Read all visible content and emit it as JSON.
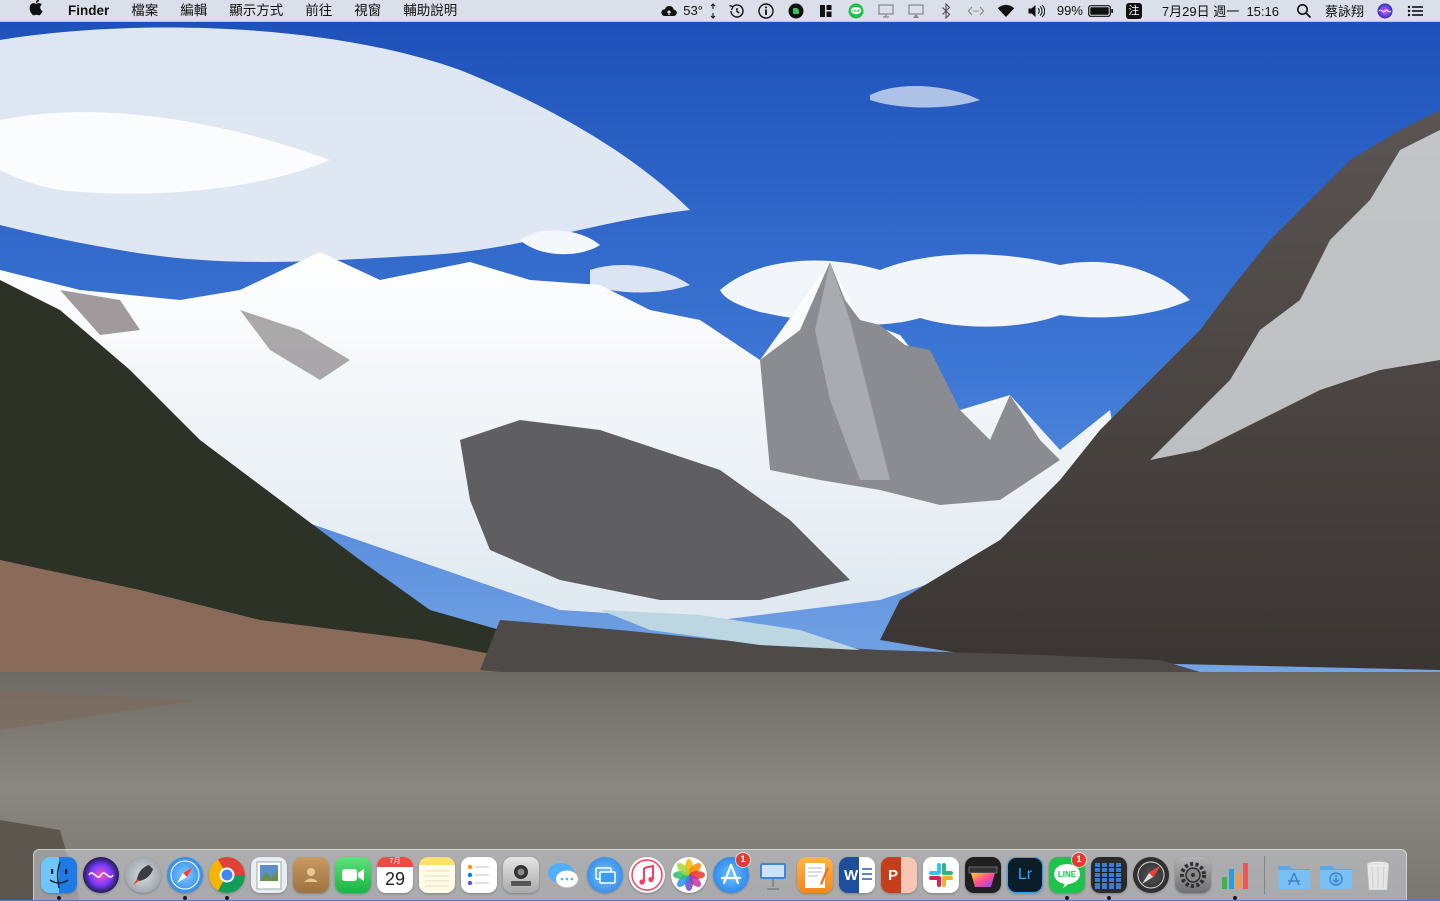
{
  "menubar": {
    "apple_icon": "apple-logo-icon",
    "app_name": "Finder",
    "menus": [
      "檔案",
      "編輯",
      "顯示方式",
      "前往",
      "視窗",
      "輔助說明"
    ],
    "weather_temp": "53°",
    "battery_percent": "99%",
    "input_method": "注",
    "datetime": "7月29日 週一  15:16",
    "user_name": "蔡詠翔",
    "status_icons": [
      "weather-cloud-icon",
      "expand-icon",
      "time-machine-icon",
      "info-icon",
      "evernote-icon",
      "layout-icon",
      "line-icon",
      "screen-mirror-icon",
      "airplay-icon",
      "bluetooth-icon",
      "network-arrows-icon",
      "wifi-icon",
      "volume-icon",
      "battery-icon",
      "input-method-icon",
      "spotlight-icon",
      "siri-icon",
      "notification-center-icon"
    ]
  },
  "calendar_icon": {
    "month": "7月",
    "day": "29"
  },
  "dock": {
    "badges": {
      "app_store": "1",
      "line": "1"
    },
    "apps": [
      {
        "name": "Finder",
        "icon": "finder-icon",
        "color": "#2f8cf0",
        "running": true
      },
      {
        "name": "Siri",
        "icon": "siri-icon",
        "color": "#3a3a8c",
        "running": false
      },
      {
        "name": "Launchpad",
        "icon": "launchpad-icon",
        "color": "#9aa3ad",
        "running": false
      },
      {
        "name": "Safari",
        "icon": "safari-icon",
        "color": "#2d8ff0",
        "running": true
      },
      {
        "name": "Chrome",
        "icon": "chrome-icon",
        "color": "#ffffff",
        "running": true
      },
      {
        "name": "Preview",
        "icon": "preview-icon",
        "color": "#6a96c8",
        "running": false
      },
      {
        "name": "Contacts",
        "icon": "contacts-icon",
        "color": "#b8874e",
        "running": false
      },
      {
        "name": "FaceTime",
        "icon": "facetime-icon",
        "color": "#33c759",
        "running": false
      },
      {
        "name": "Calendar",
        "icon": "calendar-icon",
        "color": "#ffffff",
        "running": false
      },
      {
        "name": "Notes",
        "icon": "notes-icon",
        "color": "#fbe36b",
        "running": false
      },
      {
        "name": "Reminders",
        "icon": "reminders-icon",
        "color": "#ffffff",
        "running": false
      },
      {
        "name": "Screenshot",
        "icon": "screenshot-icon",
        "color": "#c9c9c9",
        "running": false
      },
      {
        "name": "Messages",
        "icon": "messages-icon",
        "color": "#3fa7f5",
        "running": false
      },
      {
        "name": "Screen Sharing",
        "icon": "screen-sharing-icon",
        "color": "#3b9cf0",
        "running": false
      },
      {
        "name": "Music",
        "icon": "music-icon",
        "color": "#ffffff",
        "running": false
      },
      {
        "name": "Photos",
        "icon": "photos-icon",
        "color": "#ffffff",
        "running": false
      },
      {
        "name": "App Store",
        "icon": "app-store-icon",
        "color": "#1f8cf0",
        "running": false
      },
      {
        "name": "Keynote",
        "icon": "keynote-icon",
        "color": "#4f8bd8",
        "running": false
      },
      {
        "name": "Pages",
        "icon": "pages-icon",
        "color": "#f39c2e",
        "running": false
      },
      {
        "name": "Word",
        "icon": "word-icon",
        "color": "#2b5cab",
        "running": false
      },
      {
        "name": "PowerPoint",
        "icon": "powerpoint-icon",
        "color": "#d04a23",
        "running": false
      },
      {
        "name": "Slack",
        "icon": "slack-icon",
        "color": "#ffffff",
        "running": false
      },
      {
        "name": "Final Cut Pro",
        "icon": "final-cut-icon",
        "color": "#2b2b2b",
        "running": false
      },
      {
        "name": "Lightroom",
        "icon": "lightroom-icon",
        "color": "#0e2a3a",
        "running": false
      },
      {
        "name": "LINE",
        "icon": "line-icon",
        "color": "#1fc24a",
        "running": true
      },
      {
        "name": "Activity Monitor",
        "icon": "activity-monitor-icon",
        "color": "#3a3a3a",
        "running": true
      },
      {
        "name": "Safari Technology Preview",
        "icon": "compass-icon",
        "color": "#2c2c2c",
        "running": false
      },
      {
        "name": "System Preferences",
        "icon": "system-preferences-icon",
        "color": "#8e8e93",
        "running": false
      },
      {
        "name": "Numbers",
        "icon": "numbers-icon",
        "color": "#ffffff",
        "running": true
      }
    ],
    "folders": [
      {
        "name": "Applications",
        "icon": "applications-folder-icon",
        "color": "#66b6f0"
      },
      {
        "name": "Downloads",
        "icon": "downloads-folder-icon",
        "color": "#66b6f0"
      },
      {
        "name": "Trash",
        "icon": "trash-icon",
        "color": "#e6e6e6"
      }
    ]
  }
}
